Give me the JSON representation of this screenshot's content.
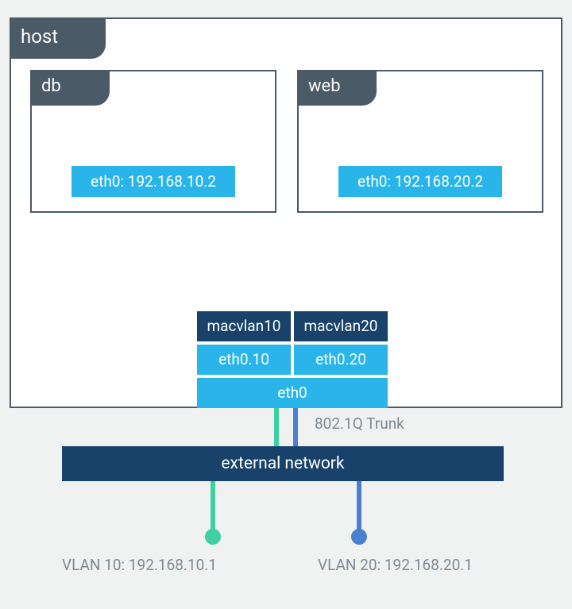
{
  "host": {
    "label": "host"
  },
  "containers": {
    "db": {
      "label": "db",
      "eth": "eth0: 192.168.10.2"
    },
    "web": {
      "label": "web",
      "eth": "eth0: 192.168.20.2"
    }
  },
  "macvlan": {
    "left": "macvlan10",
    "right": "macvlan20"
  },
  "subeth": {
    "left": "eth0.10",
    "right": "eth0.20"
  },
  "eth0": "eth0",
  "trunk": "802.1Q Trunk",
  "external": {
    "label": "external network"
  },
  "vlan": {
    "left": "VLAN 10: 192.168.10.1",
    "right": "VLAN 20: 192.168.20.1"
  },
  "colors": {
    "green": "#3ecfa3",
    "blue": "#4a80cf",
    "slate": "#4a5a66",
    "sky": "#29b5ea",
    "navy": "#18426a"
  }
}
